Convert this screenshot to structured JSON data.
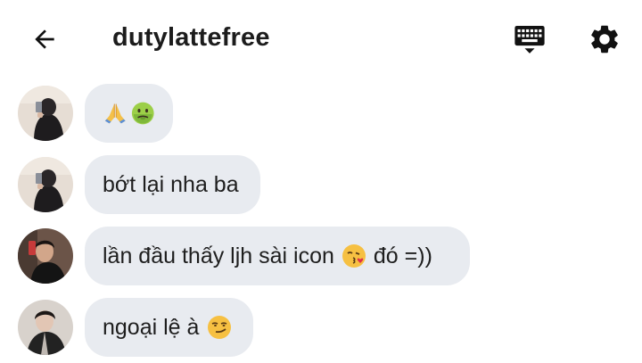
{
  "header": {
    "title": "dutylattefree",
    "back_icon": "arrow-left-icon",
    "keyboard_icon": "keyboard-icon",
    "settings_icon": "gear-icon"
  },
  "messages": [
    {
      "text": "",
      "emojis": [
        "folded-hands-emoji",
        "nauseated-face-emoji"
      ]
    },
    {
      "text": "bớt lại nha ba"
    },
    {
      "text": "lần đầu thấy ljh sài icon",
      "emoji": "face-blowing-kiss-emoji",
      "suffix": "đó =))"
    },
    {
      "text": "ngoại lệ à",
      "emoji": "smirking-face-emoji"
    }
  ],
  "colors": {
    "bubble": "#e8ebf0",
    "text": "#1e1e1e",
    "background": "#ffffff"
  }
}
